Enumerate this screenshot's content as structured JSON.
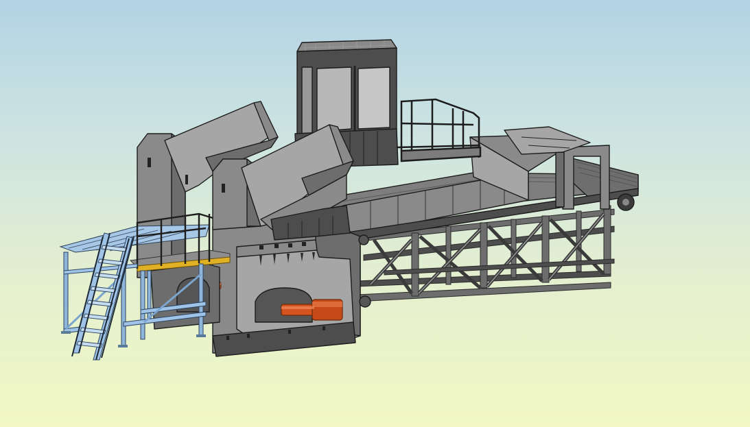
{
  "scene": {
    "colors": {
      "background_top": "#b3d3e5",
      "background_bottom": "#f1f8c4",
      "steel": "#8a8a8a",
      "steel_dark": "#4d4d4d",
      "steel_light": "#a6a6a6",
      "cylinder": "#d4531e",
      "platform_structure": "#9fc3e6",
      "walkway_edge": "#e0b025"
    }
  }
}
